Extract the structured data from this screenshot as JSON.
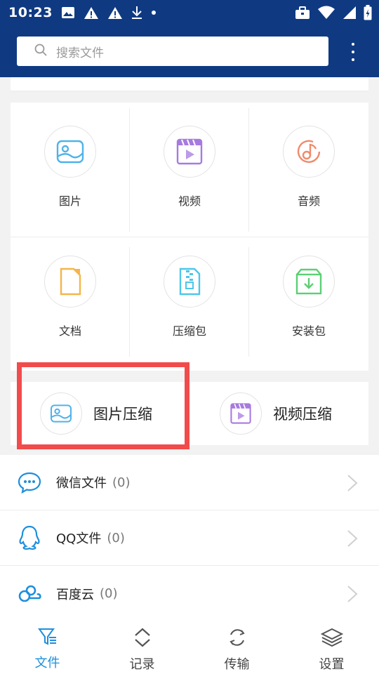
{
  "status_bar": {
    "time": "10:23",
    "icons": [
      "image-icon",
      "alert-icon",
      "alert-icon",
      "download-icon",
      "dot-icon",
      "briefcase-icon",
      "wifi-icon",
      "signal-icon",
      "battery-icon"
    ]
  },
  "header": {
    "search_placeholder": "搜索文件",
    "search_icon": "search-icon",
    "more_icon": "more-vertical-icon",
    "background": "#0f3a82"
  },
  "categories": [
    {
      "label": "图片",
      "icon": "image-icon",
      "color": "#4fb3e8"
    },
    {
      "label": "视频",
      "icon": "video-icon",
      "color": "#a77ae0"
    },
    {
      "label": "音频",
      "icon": "audio-icon",
      "color": "#f08a6a"
    },
    {
      "label": "文档",
      "icon": "document-icon",
      "color": "#f5b54a"
    },
    {
      "label": "压缩包",
      "icon": "zip-icon",
      "color": "#4fc6e8"
    },
    {
      "label": "安装包",
      "icon": "package-icon",
      "color": "#5ccf74"
    }
  ],
  "compress": [
    {
      "label": "图片压缩",
      "icon": "image-compress-icon"
    },
    {
      "label": "视频压缩",
      "icon": "video-compress-icon"
    }
  ],
  "list": [
    {
      "name": "微信文件",
      "count": "(0)",
      "icon": "wechat-icon"
    },
    {
      "name": "QQ文件",
      "count": "(0)",
      "icon": "qq-icon"
    },
    {
      "name": "百度云",
      "count": "(0)",
      "icon": "baidu-cloud-icon"
    }
  ],
  "nav": [
    {
      "label": "文件",
      "icon": "files-icon",
      "active": true
    },
    {
      "label": "记录",
      "icon": "records-icon",
      "active": false
    },
    {
      "label": "传输",
      "icon": "transfer-icon",
      "active": false
    },
    {
      "label": "设置",
      "icon": "settings-icon",
      "active": false
    }
  ],
  "colors": {
    "accent": "#1e8fdc",
    "highlight_border": "#f24b4b"
  }
}
